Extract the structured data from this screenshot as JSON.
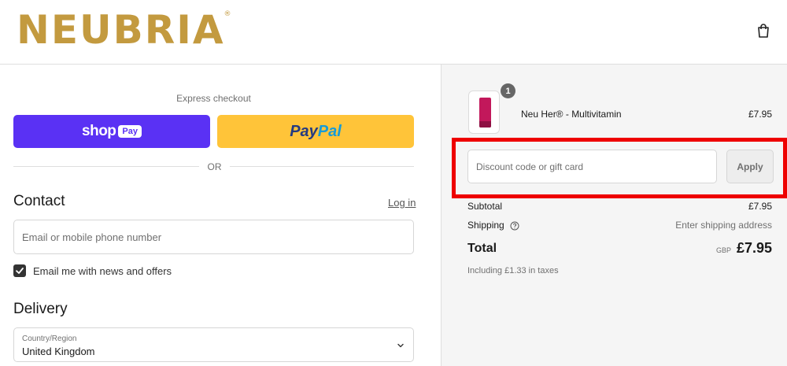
{
  "header": {
    "logo_text": "NEUBRIA",
    "logo_mark": "®",
    "cart_icon": "shopping-bag-icon",
    "brand_color": "#c39a3f"
  },
  "express": {
    "title": "Express checkout",
    "shop_pay_word": "shop",
    "shop_pay_badge": "Pay",
    "paypal_a": "Pay",
    "paypal_b": "Pal",
    "or_text": "OR",
    "shop_pay_color": "#5a31f4",
    "paypal_color": "#ffc439"
  },
  "contact": {
    "heading": "Contact",
    "login_link": "Log in",
    "email_placeholder": "Email or mobile phone number",
    "email_value": "",
    "news_checkbox_label": "Email me with news and offers",
    "news_checked": true
  },
  "delivery": {
    "heading": "Delivery",
    "country_caption": "Country/Region",
    "country_value": "United Kingdom"
  },
  "summary": {
    "item": {
      "name": "Neu Her® - Multivitamin",
      "price": "£7.95",
      "quantity": "1"
    },
    "discount_placeholder": "Discount code or gift card",
    "apply_label": "Apply",
    "subtotal_label": "Subtotal",
    "subtotal_value": "£7.95",
    "shipping_label": "Shipping",
    "shipping_value": "Enter shipping address",
    "total_label": "Total",
    "total_currency": "GBP",
    "total_value": "£7.95",
    "taxes_note": "Including £1.33 in taxes",
    "highlight_color": "#ee0000"
  }
}
